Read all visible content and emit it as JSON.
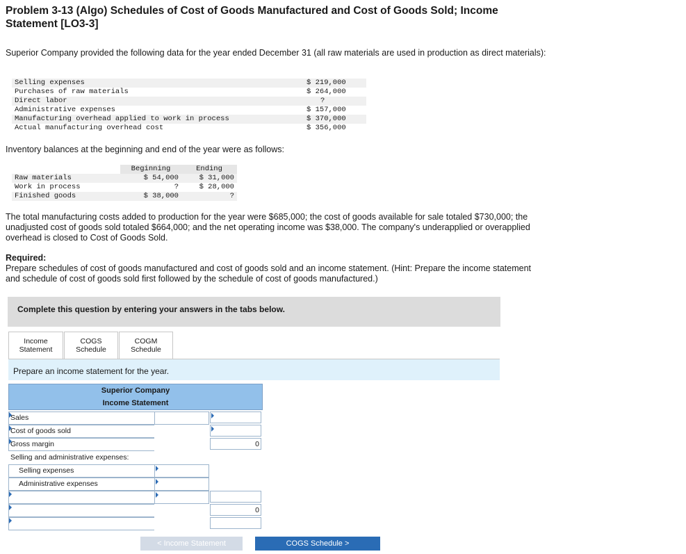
{
  "title": "Problem 3-13 (Algo) Schedules of Cost of Goods Manufactured and Cost of Goods Sold; Income Statement [LO3-3]",
  "intro": "Superior Company provided the following data for the year ended December 31 (all raw materials are used in production as direct materials):",
  "data_rows": [
    {
      "label": "Selling expenses",
      "value": "$ 219,000"
    },
    {
      "label": "Purchases of raw materials",
      "value": "$ 264,000"
    },
    {
      "label": "Direct labor",
      "value": "?"
    },
    {
      "label": "Administrative expenses",
      "value": "$ 157,000"
    },
    {
      "label": "Manufacturing overhead applied to work in process",
      "value": "$ 370,000"
    },
    {
      "label": "Actual manufacturing overhead cost",
      "value": "$ 356,000"
    }
  ],
  "inventory_heading": "Inventory balances at the beginning and end of the year were as follows:",
  "inventory": {
    "col_beginning": "Beginning",
    "col_ending": "Ending",
    "rows": [
      {
        "label": "Raw materials",
        "beginning": "$ 54,000",
        "ending": "$ 31,000"
      },
      {
        "label": "Work in process",
        "beginning": "?",
        "ending": "$ 28,000"
      },
      {
        "label": "Finished goods",
        "beginning": "$ 38,000",
        "ending": "?"
      }
    ]
  },
  "paragraph": "The total manufacturing costs added to production for the year were $685,000; the cost of goods available for sale totaled $730,000; the unadjusted cost of goods sold totaled $664,000; and the net operating income was $38,000. The company's underapplied or overapplied overhead is closed to Cost of Goods Sold.",
  "required_title": "Required:",
  "required_text": "Prepare schedules of cost of goods manufactured and cost of goods sold and an income statement. (Hint: Prepare the income statement and schedule of cost of goods sold first followed by the schedule of cost of goods manufactured.)",
  "complete_bar": "Complete this question by entering your answers in the tabs below.",
  "tabs": [
    {
      "line1": "Income",
      "line2": "Statement"
    },
    {
      "line1": "COGS",
      "line2": "Schedule"
    },
    {
      "line1": "COGM",
      "line2": "Schedule"
    }
  ],
  "prep_text": "Prepare an income statement for the year.",
  "statement": {
    "company": "Superior Company",
    "name": "Income Statement",
    "rows": [
      {
        "label": "Sales",
        "mid": "",
        "right": ""
      },
      {
        "label": "Cost of goods sold",
        "mid": "",
        "right": ""
      },
      {
        "label": "Gross margin",
        "mid": "",
        "right": "0"
      },
      {
        "label": "Selling and administrative expenses:",
        "mid": "",
        "right": ""
      },
      {
        "label": "Selling expenses",
        "mid": "",
        "right": ""
      },
      {
        "label": "Administrative expenses",
        "mid": "",
        "right": ""
      },
      {
        "label": "",
        "mid": "",
        "right": ""
      },
      {
        "label": "",
        "mid": "",
        "right": "0"
      },
      {
        "label": "",
        "mid": "",
        "right": ""
      }
    ]
  },
  "nav": {
    "prev_label": "< Income Statement",
    "next_label": "COGS Schedule >"
  },
  "colors": {
    "accent": "#2a6cb5",
    "header_blue": "#92c0ea",
    "prep_bar": "#dff1fb"
  }
}
